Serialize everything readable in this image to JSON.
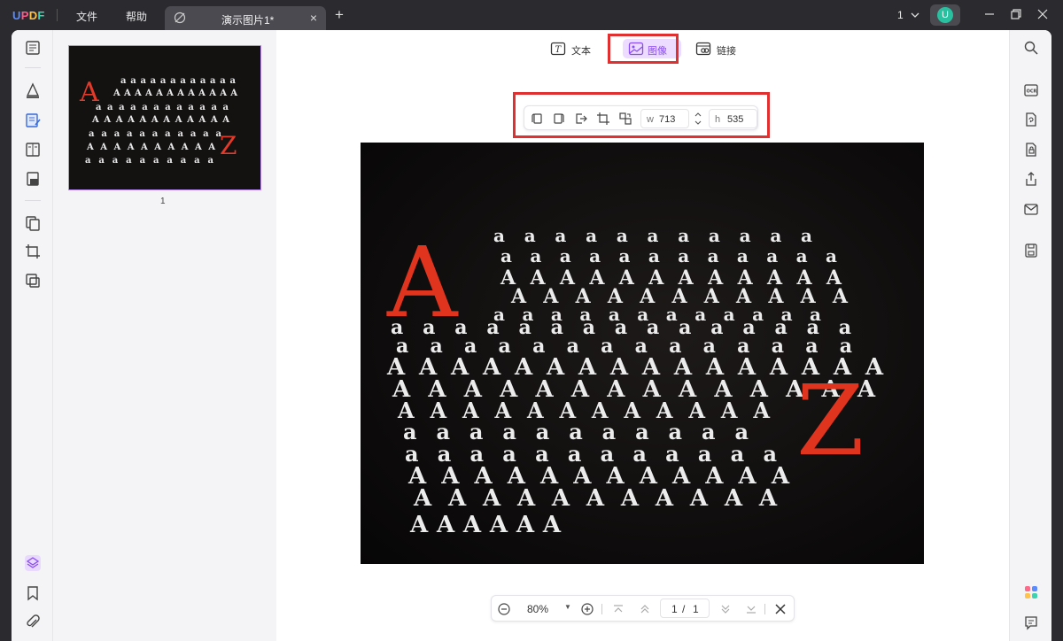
{
  "app": {
    "logo": "UPDF"
  },
  "menu": {
    "file": "文件",
    "help": "帮助"
  },
  "tab": {
    "title": "演示图片1*",
    "close": "×",
    "add": "+"
  },
  "header": {
    "page_indicator": "1",
    "avatar_letter": "U"
  },
  "modes": {
    "text": "文本",
    "image": "图像",
    "link": "链接"
  },
  "image_toolbar": {
    "width_label": "w",
    "width_value": "713",
    "height_label": "h",
    "height_value": "535"
  },
  "thumbnail": {
    "page_number": "1"
  },
  "zoom": {
    "value": "80%",
    "page_current": "1",
    "page_sep": "/",
    "page_total": "1"
  },
  "colors": {
    "accent": "#a86bff",
    "highlight": "#e03030",
    "bg_dark": "#2b2b2f"
  }
}
